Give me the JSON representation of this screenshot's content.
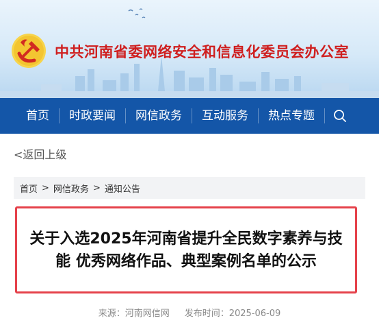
{
  "header": {
    "site_title": "中共河南省委网络安全和信息化委员会办公室",
    "brand_color": "#cf1f1f"
  },
  "nav": {
    "background": "#1456a8",
    "items": [
      "首页",
      "时政要闻",
      "网信政务",
      "互动服务",
      "热点专题"
    ],
    "search_icon": "search-icon"
  },
  "back_link": "<返回上级",
  "breadcrumb": {
    "items": [
      "首页",
      "网信政务",
      "通知公告"
    ],
    "separator": ">"
  },
  "article": {
    "title": "关于入选2025年河南省提升全民数字素养与技能 优秀网络作品、典型案例名单的公示",
    "source_label": "来源：河南网信网",
    "date_label": "发布时间：2025-06-09",
    "highlight_border_color": "#e5414a"
  }
}
